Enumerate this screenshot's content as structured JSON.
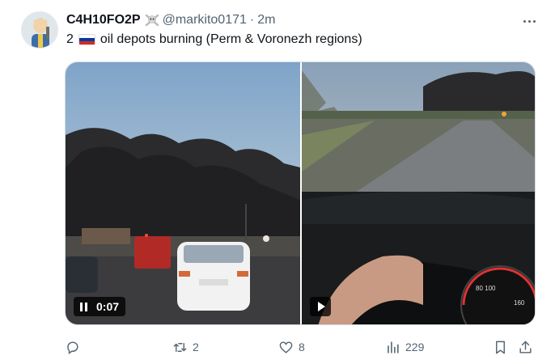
{
  "tweet": {
    "display_name": "C4H10FO2P",
    "handle": "@markito0171",
    "separator": "·",
    "time": "2m",
    "text_number": "2",
    "text_body": "oil depots burning (Perm & Voronezh regions)",
    "flag_icon": "russia-flag-icon",
    "flag_colors": [
      "#ffffff",
      "#0039a6",
      "#d52b1e"
    ]
  },
  "media": {
    "video_left": {
      "duration": "0:07",
      "state_icon": "pause-icon"
    },
    "video_right": {
      "state_icon": "play-icon"
    }
  },
  "actions": {
    "reply": {
      "icon": "reply-icon",
      "count": ""
    },
    "retweet": {
      "icon": "retweet-icon",
      "count": "2"
    },
    "like": {
      "icon": "heart-icon",
      "count": "8"
    },
    "views": {
      "icon": "views-icon",
      "count": "229"
    },
    "bookmark": {
      "icon": "bookmark-icon"
    },
    "share": {
      "icon": "share-icon"
    }
  },
  "colors": {
    "text_primary": "#0f1419",
    "text_secondary": "#536471",
    "border": "#cfd9de"
  }
}
